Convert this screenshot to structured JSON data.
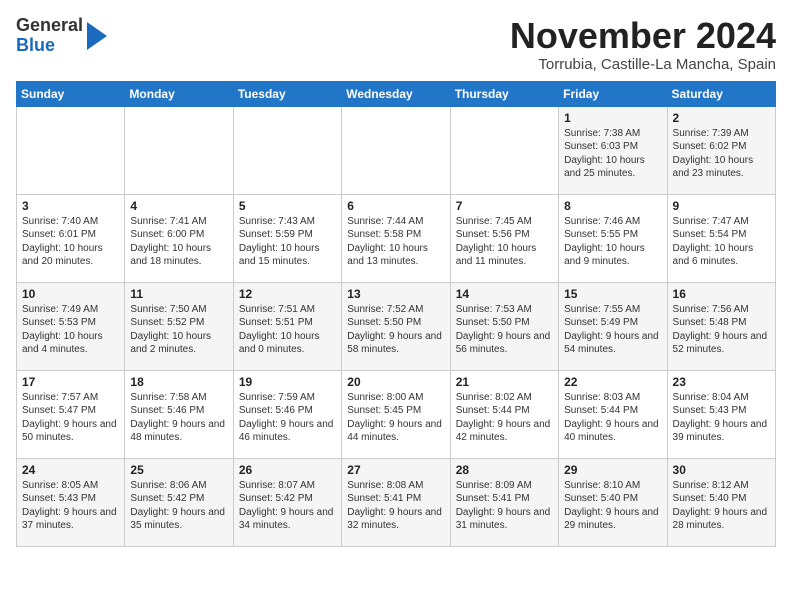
{
  "header": {
    "logo_line1": "General",
    "logo_line2": "Blue",
    "month": "November 2024",
    "location": "Torrubia, Castille-La Mancha, Spain"
  },
  "weekdays": [
    "Sunday",
    "Monday",
    "Tuesday",
    "Wednesday",
    "Thursday",
    "Friday",
    "Saturday"
  ],
  "weeks": [
    [
      {
        "day": "",
        "info": ""
      },
      {
        "day": "",
        "info": ""
      },
      {
        "day": "",
        "info": ""
      },
      {
        "day": "",
        "info": ""
      },
      {
        "day": "",
        "info": ""
      },
      {
        "day": "1",
        "info": "Sunrise: 7:38 AM\nSunset: 6:03 PM\nDaylight: 10 hours and 25 minutes."
      },
      {
        "day": "2",
        "info": "Sunrise: 7:39 AM\nSunset: 6:02 PM\nDaylight: 10 hours and 23 minutes."
      }
    ],
    [
      {
        "day": "3",
        "info": "Sunrise: 7:40 AM\nSunset: 6:01 PM\nDaylight: 10 hours and 20 minutes."
      },
      {
        "day": "4",
        "info": "Sunrise: 7:41 AM\nSunset: 6:00 PM\nDaylight: 10 hours and 18 minutes."
      },
      {
        "day": "5",
        "info": "Sunrise: 7:43 AM\nSunset: 5:59 PM\nDaylight: 10 hours and 15 minutes."
      },
      {
        "day": "6",
        "info": "Sunrise: 7:44 AM\nSunset: 5:58 PM\nDaylight: 10 hours and 13 minutes."
      },
      {
        "day": "7",
        "info": "Sunrise: 7:45 AM\nSunset: 5:56 PM\nDaylight: 10 hours and 11 minutes."
      },
      {
        "day": "8",
        "info": "Sunrise: 7:46 AM\nSunset: 5:55 PM\nDaylight: 10 hours and 9 minutes."
      },
      {
        "day": "9",
        "info": "Sunrise: 7:47 AM\nSunset: 5:54 PM\nDaylight: 10 hours and 6 minutes."
      }
    ],
    [
      {
        "day": "10",
        "info": "Sunrise: 7:49 AM\nSunset: 5:53 PM\nDaylight: 10 hours and 4 minutes."
      },
      {
        "day": "11",
        "info": "Sunrise: 7:50 AM\nSunset: 5:52 PM\nDaylight: 10 hours and 2 minutes."
      },
      {
        "day": "12",
        "info": "Sunrise: 7:51 AM\nSunset: 5:51 PM\nDaylight: 10 hours and 0 minutes."
      },
      {
        "day": "13",
        "info": "Sunrise: 7:52 AM\nSunset: 5:50 PM\nDaylight: 9 hours and 58 minutes."
      },
      {
        "day": "14",
        "info": "Sunrise: 7:53 AM\nSunset: 5:50 PM\nDaylight: 9 hours and 56 minutes."
      },
      {
        "day": "15",
        "info": "Sunrise: 7:55 AM\nSunset: 5:49 PM\nDaylight: 9 hours and 54 minutes."
      },
      {
        "day": "16",
        "info": "Sunrise: 7:56 AM\nSunset: 5:48 PM\nDaylight: 9 hours and 52 minutes."
      }
    ],
    [
      {
        "day": "17",
        "info": "Sunrise: 7:57 AM\nSunset: 5:47 PM\nDaylight: 9 hours and 50 minutes."
      },
      {
        "day": "18",
        "info": "Sunrise: 7:58 AM\nSunset: 5:46 PM\nDaylight: 9 hours and 48 minutes."
      },
      {
        "day": "19",
        "info": "Sunrise: 7:59 AM\nSunset: 5:46 PM\nDaylight: 9 hours and 46 minutes."
      },
      {
        "day": "20",
        "info": "Sunrise: 8:00 AM\nSunset: 5:45 PM\nDaylight: 9 hours and 44 minutes."
      },
      {
        "day": "21",
        "info": "Sunrise: 8:02 AM\nSunset: 5:44 PM\nDaylight: 9 hours and 42 minutes."
      },
      {
        "day": "22",
        "info": "Sunrise: 8:03 AM\nSunset: 5:44 PM\nDaylight: 9 hours and 40 minutes."
      },
      {
        "day": "23",
        "info": "Sunrise: 8:04 AM\nSunset: 5:43 PM\nDaylight: 9 hours and 39 minutes."
      }
    ],
    [
      {
        "day": "24",
        "info": "Sunrise: 8:05 AM\nSunset: 5:43 PM\nDaylight: 9 hours and 37 minutes."
      },
      {
        "day": "25",
        "info": "Sunrise: 8:06 AM\nSunset: 5:42 PM\nDaylight: 9 hours and 35 minutes."
      },
      {
        "day": "26",
        "info": "Sunrise: 8:07 AM\nSunset: 5:42 PM\nDaylight: 9 hours and 34 minutes."
      },
      {
        "day": "27",
        "info": "Sunrise: 8:08 AM\nSunset: 5:41 PM\nDaylight: 9 hours and 32 minutes."
      },
      {
        "day": "28",
        "info": "Sunrise: 8:09 AM\nSunset: 5:41 PM\nDaylight: 9 hours and 31 minutes."
      },
      {
        "day": "29",
        "info": "Sunrise: 8:10 AM\nSunset: 5:40 PM\nDaylight: 9 hours and 29 minutes."
      },
      {
        "day": "30",
        "info": "Sunrise: 8:12 AM\nSunset: 5:40 PM\nDaylight: 9 hours and 28 minutes."
      }
    ]
  ]
}
